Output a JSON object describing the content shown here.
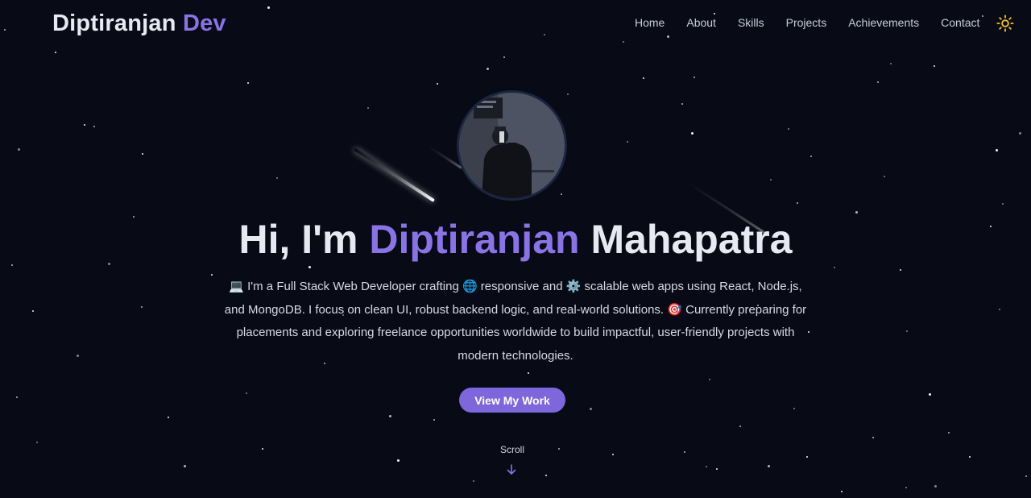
{
  "brand": {
    "name": "Diptiranjan",
    "accent": "Dev"
  },
  "nav": {
    "items": [
      "Home",
      "About",
      "Skills",
      "Projects",
      "Achievements",
      "Contact"
    ]
  },
  "theme_toggle": {
    "icon": "sun-icon"
  },
  "hero": {
    "avatar_alt": "Profile photo",
    "title_prefix": "Hi, I'm",
    "title_first": "Diptiranjan",
    "title_last": "Mahapatra",
    "description": "💻 I'm a Full Stack Web Developer crafting 🌐 responsive and ⚙️ scalable web apps using React, Node.js, and MongoDB. I focus on clean UI, robust backend logic, and real-world solutions. 🎯 Currently preparing for placements and exploring freelance opportunities worldwide to build impactful, user-friendly projects with modern technologies.",
    "cta_label": "View My Work",
    "scroll_label": "Scroll"
  },
  "colors": {
    "background": "#080b16",
    "accent": "#8a73e6",
    "button": "#7e66dc",
    "sun": "#f5c518"
  }
}
